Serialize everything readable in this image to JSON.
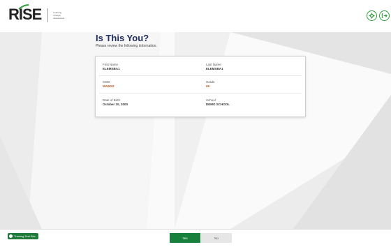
{
  "header": {
    "logo_text": "RISE",
    "logo_sub": "Learning through assessment",
    "icons": {
      "settings": "settings-icon",
      "logout": "logout-icon"
    }
  },
  "page": {
    "title": "Is This You?",
    "subtitle": "Please review the following information."
  },
  "student": {
    "first_name": {
      "label": "First Name",
      "value": "ELEMSBA1"
    },
    "last_name": {
      "label": "Last Name",
      "value": "ELEMSBA1"
    },
    "ssid": {
      "label": "SSID",
      "value": "WAMS2"
    },
    "grade": {
      "label": "Grade",
      "value": "05"
    },
    "dob": {
      "label": "Date of Birth",
      "value": "October 10, 2000"
    },
    "school": {
      "label": "School",
      "value": "DEMO SCHOOL"
    }
  },
  "footer": {
    "training_label": "Training Test Site",
    "yes_label": "Yes",
    "no_label": "No"
  },
  "colors": {
    "brand_green": "#17803c",
    "title_navy": "#1f2d5c",
    "accent_orange": "#b3541e"
  }
}
